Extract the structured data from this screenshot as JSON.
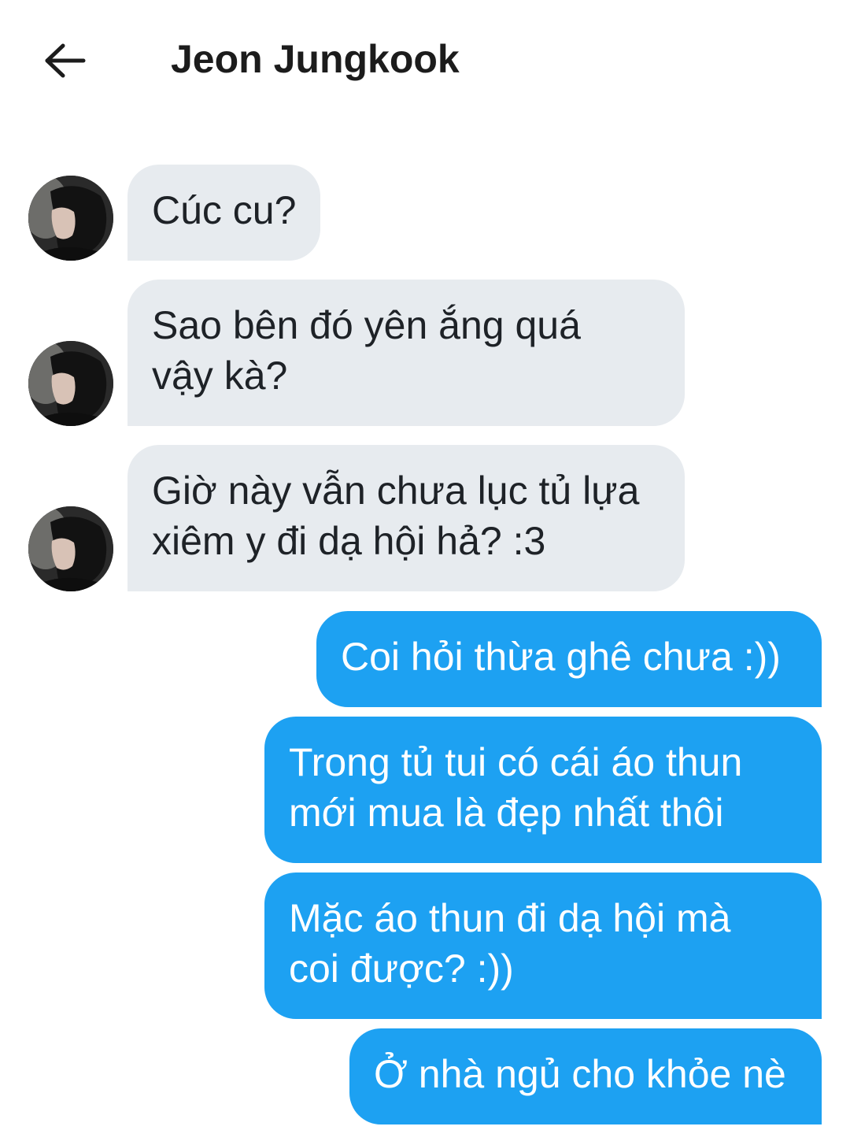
{
  "header": {
    "title": "Jeon Jungkook",
    "back_icon": "arrow-left-icon"
  },
  "contact": {
    "avatar_icon": "avatar-photo"
  },
  "colors": {
    "incoming_bubble": "#e7ebef",
    "outgoing_bubble": "#1da1f2",
    "incoming_text": "#1e2227",
    "outgoing_text": "#ffffff"
  },
  "messages": [
    {
      "from": "contact",
      "text": "Cúc cu?"
    },
    {
      "from": "contact",
      "text": "Sao bên đó yên ắng quá\nvậy kà?"
    },
    {
      "from": "contact",
      "text": "Giờ này vẫn chưa lục tủ lựa\nxiêm y đi dạ hội hả? :3"
    },
    {
      "from": "me",
      "text": "Coi hỏi thừa ghê chưa :))"
    },
    {
      "from": "me",
      "text": "Trong tủ tui có cái áo thun\nmới mua là đẹp nhất thôi"
    },
    {
      "from": "me",
      "text": "Mặc áo thun đi dạ hội mà\ncoi được? :))"
    },
    {
      "from": "me",
      "text": "Ở nhà ngủ cho khỏe nè"
    }
  ]
}
